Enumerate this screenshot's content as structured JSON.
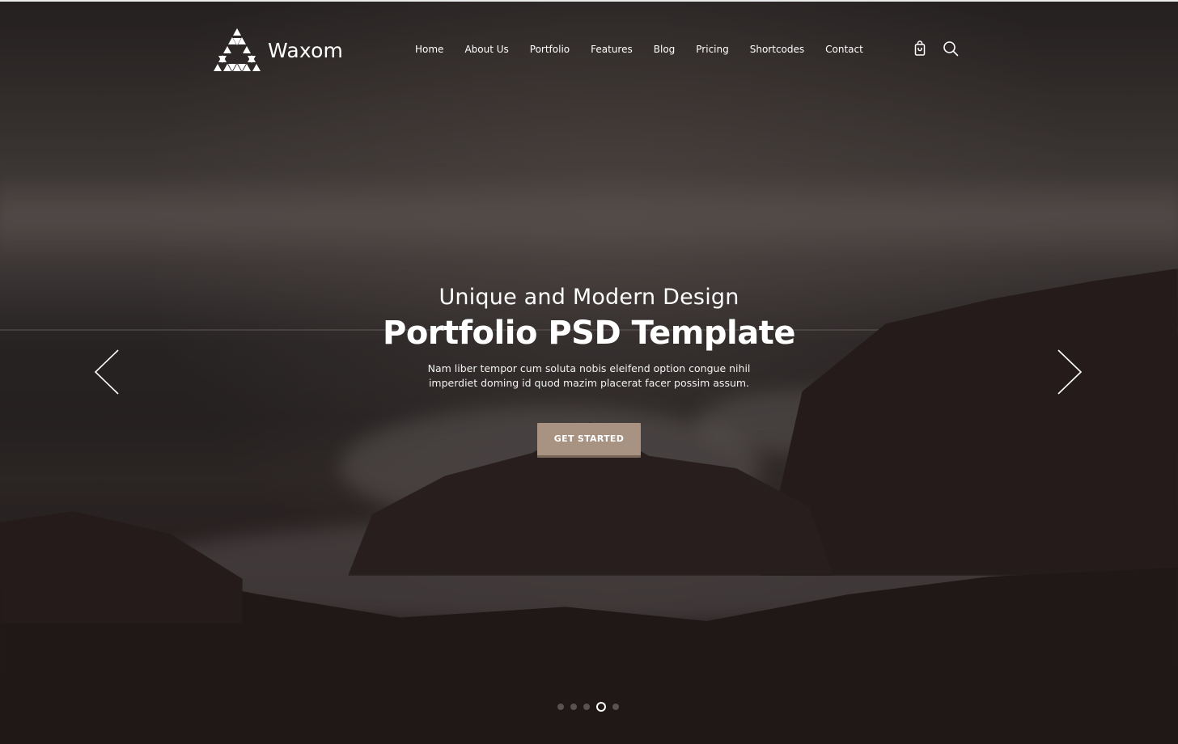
{
  "brand": {
    "name": "Waxom",
    "logo_icon": "triangle-logo-icon"
  },
  "nav": {
    "items": [
      {
        "label": "Home"
      },
      {
        "label": "About Us"
      },
      {
        "label": "Portfolio"
      },
      {
        "label": "Features"
      },
      {
        "label": "Blog"
      },
      {
        "label": "Pricing"
      },
      {
        "label": "Shortcodes"
      },
      {
        "label": "Contact"
      }
    ],
    "icons": [
      "shopping-bag-icon",
      "search-icon"
    ]
  },
  "hero": {
    "subtitle": "Unique and Modern Design",
    "title": "Portfolio PSD Template",
    "description": "Nam liber tempor cum soluta nobis eleifend option congue nihil imperdiet doming id quod mazim placerat facer possim assum.",
    "cta_label": "GET STARTED",
    "prev_icon": "chevron-left-icon",
    "next_icon": "chevron-right-icon"
  },
  "slider": {
    "total_slides": 5,
    "active_slide": 4
  },
  "colors": {
    "accent": "#a89282",
    "text": "#ffffff"
  }
}
